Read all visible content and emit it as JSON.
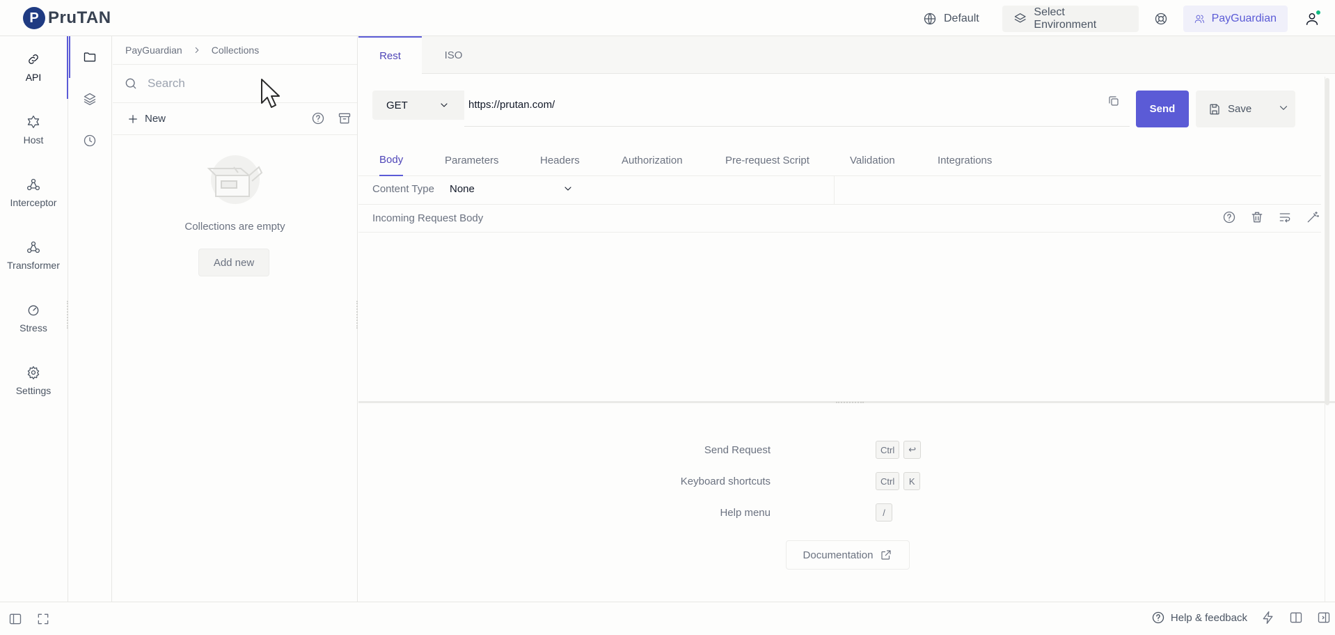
{
  "app": {
    "name": "PruTAN",
    "logo_letter": "P"
  },
  "topbar": {
    "default_label": "Default",
    "environment_label": "Select Environment",
    "workspace_label": "PayGuardian",
    "account_status": "online"
  },
  "rail": {
    "items": [
      {
        "label": "API",
        "icon": "link-icon",
        "active": true
      },
      {
        "label": "Host",
        "icon": "host-icon",
        "active": false
      },
      {
        "label": "Interceptor",
        "icon": "interceptor-icon",
        "active": false
      },
      {
        "label": "Transformer",
        "icon": "transformer-icon",
        "active": false
      },
      {
        "label": "Stress",
        "icon": "gauge-icon",
        "active": false
      },
      {
        "label": "Settings",
        "icon": "gear-icon",
        "active": false
      }
    ]
  },
  "subrail": {
    "items": [
      {
        "icon": "folder-icon",
        "active": true
      },
      {
        "icon": "layers-icon",
        "active": false
      },
      {
        "icon": "clock-icon",
        "active": false
      }
    ]
  },
  "collections": {
    "breadcrumb": [
      "PayGuardian",
      "Collections"
    ],
    "search_placeholder": "Search",
    "new_label": "New",
    "empty_text": "Collections are empty",
    "add_new_label": "Add new"
  },
  "main": {
    "tabs": [
      {
        "label": "Rest",
        "active": true
      },
      {
        "label": "ISO",
        "active": false
      }
    ],
    "request": {
      "method": "GET",
      "url": "https://prutan.com/",
      "send_label": "Send",
      "save_label": "Save"
    },
    "request_tabs": [
      {
        "label": "Body",
        "active": true
      },
      {
        "label": "Parameters",
        "active": false
      },
      {
        "label": "Headers",
        "active": false
      },
      {
        "label": "Authorization",
        "active": false
      },
      {
        "label": "Pre-request Script",
        "active": false
      },
      {
        "label": "Validation",
        "active": false
      },
      {
        "label": "Integrations",
        "active": false
      }
    ],
    "content_type_label": "Content Type",
    "content_type_value": "None",
    "body_label": "Incoming Request Body",
    "shortcuts": [
      {
        "label": "Send Request",
        "keys": [
          "Ctrl",
          "↩"
        ]
      },
      {
        "label": "Keyboard shortcuts",
        "keys": [
          "Ctrl",
          "K"
        ]
      },
      {
        "label": "Help menu",
        "keys": [
          "/"
        ]
      }
    ],
    "documentation_label": "Documentation"
  },
  "bottombar": {
    "help_label": "Help & feedback"
  },
  "colors": {
    "accent": "#5b5bd6",
    "brand": "#1f3b82",
    "status_online": "#10b981"
  }
}
